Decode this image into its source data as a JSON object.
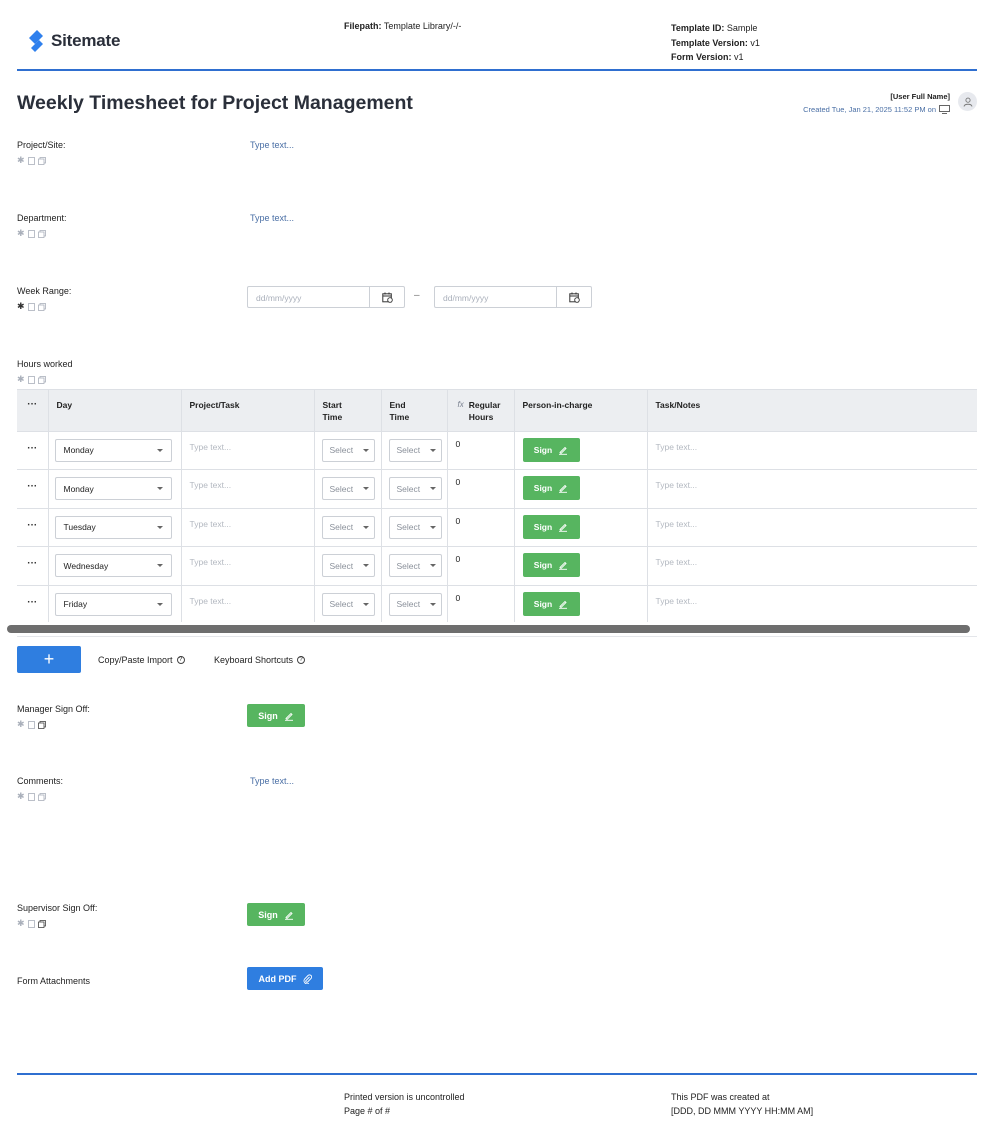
{
  "header": {
    "brand": "Sitemate",
    "filepath_label": "Filepath:",
    "filepath_value": "Template Library/-/-",
    "template_id_label": "Template ID:",
    "template_id_value": "Sample",
    "template_version_label": "Template Version:",
    "template_version_value": "v1",
    "form_version_label": "Form Version:",
    "form_version_value": "v1",
    "brand_color": "#2f80ed"
  },
  "form": {
    "title": "Weekly Timesheet for Project Management",
    "user_name": "[User Full Name]",
    "created": "Created Tue, Jan 21, 2025 11:52 PM on"
  },
  "fields": {
    "project_site": {
      "label": "Project/Site:",
      "placeholder": "Type text..."
    },
    "department": {
      "label": "Department:",
      "placeholder": "Type text..."
    },
    "week_range": {
      "label": "Week Range:",
      "start_placeholder": "dd/mm/yyyy",
      "end_placeholder": "dd/mm/yyyy",
      "separator": "–"
    },
    "hours_worked": {
      "label": "Hours worked"
    },
    "manager_signoff": {
      "label": "Manager Sign Off:",
      "button": "Sign"
    },
    "comments": {
      "label": "Comments:",
      "placeholder": "Type text..."
    },
    "supervisor_signoff": {
      "label": "Supervisor Sign Off:",
      "button": "Sign"
    },
    "attachments": {
      "label": "Form Attachments",
      "button": "Add PDF"
    }
  },
  "table": {
    "columns": {
      "menu": "···",
      "day": "Day",
      "project_task": "Project/Task",
      "start_time_1": "Start",
      "start_time_2": "Time",
      "end_time_1": "End",
      "end_time_2": "Time",
      "fx": "fx",
      "regular_hours_1": "Regular",
      "regular_hours_2": "Hours",
      "person": "Person-in-charge",
      "notes": "Task/Notes"
    },
    "rows": [
      {
        "menu": "···",
        "day": "Monday",
        "task": "Type text...",
        "start": "Select",
        "end": "Select",
        "hours": "0",
        "sign": "Sign",
        "notes": "Type text..."
      },
      {
        "menu": "···",
        "day": "Monday",
        "task": "Type text...",
        "start": "Select",
        "end": "Select",
        "hours": "0",
        "sign": "Sign",
        "notes": "Type text..."
      },
      {
        "menu": "···",
        "day": "Tuesday",
        "task": "Type text...",
        "start": "Select",
        "end": "Select",
        "hours": "0",
        "sign": "Sign",
        "notes": "Type text..."
      },
      {
        "menu": "···",
        "day": "Wednesday",
        "task": "Type text...",
        "start": "Select",
        "end": "Select",
        "hours": "0",
        "sign": "Sign",
        "notes": "Type text..."
      },
      {
        "menu": "···",
        "day": "Friday",
        "task": "Type text...",
        "start": "Select",
        "end": "Select",
        "hours": "0",
        "sign": "Sign",
        "notes": "Type text..."
      }
    ],
    "add_label": "+",
    "copy_paste": "Copy/Paste Import",
    "shortcuts": "Keyboard Shortcuts"
  },
  "footer": {
    "uncontrolled": "Printed version is uncontrolled",
    "page": "Page # of #",
    "created_at": "This PDF was created at",
    "created_date": "[DDD, DD MMM YYYY HH:MM AM]"
  },
  "icons": {
    "required": "asterisk-icon",
    "note": "note-icon",
    "copy": "copy-icon",
    "calendar": "calendar-icon",
    "pen": "pen-icon",
    "paperclip": "paperclip-icon",
    "user": "user-icon",
    "monitor": "monitor-icon",
    "help": "help-icon"
  },
  "colors": {
    "accent_blue": "#2f7ee0",
    "sign_green": "#57b560",
    "divider_blue": "#2f6fd0"
  }
}
